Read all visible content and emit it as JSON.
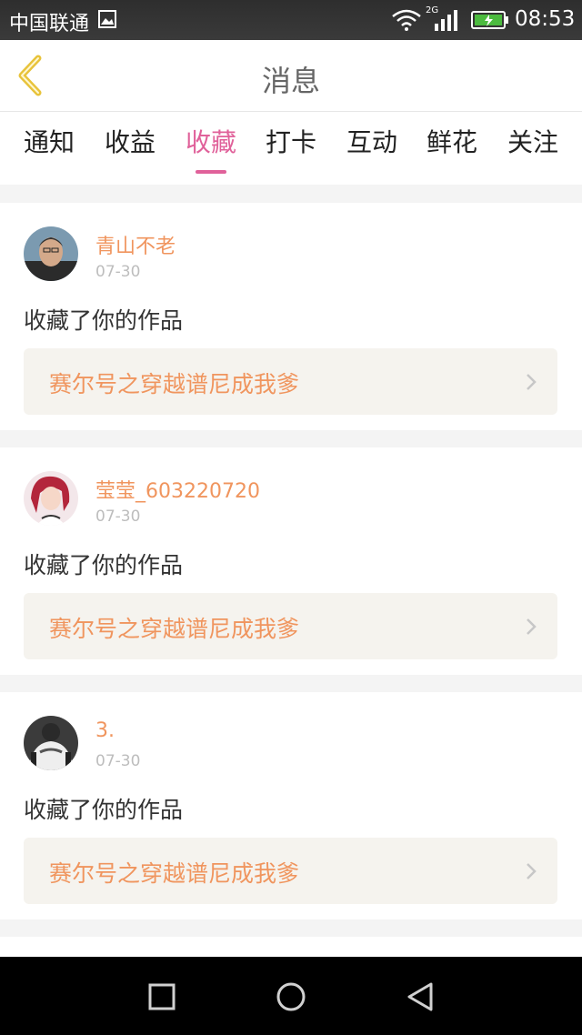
{
  "status_bar": {
    "carrier": "中国联通",
    "network": "2G",
    "time": "08:53"
  },
  "header": {
    "title": "消息"
  },
  "tabs": [
    {
      "label": "通知",
      "active": false
    },
    {
      "label": "收益",
      "active": false
    },
    {
      "label": "收藏",
      "active": true
    },
    {
      "label": "打卡",
      "active": false
    },
    {
      "label": "互动",
      "active": false
    },
    {
      "label": "鲜花",
      "active": false
    },
    {
      "label": "关注",
      "active": false
    }
  ],
  "messages": [
    {
      "username": "青山不老",
      "date": "07-30",
      "action": "收藏了你的作品",
      "work_title": "赛尔号之穿越谱尼成我爹"
    },
    {
      "username": "莹莹_603220720",
      "date": "07-30",
      "action": "收藏了你的作品",
      "work_title": "赛尔号之穿越谱尼成我爹"
    },
    {
      "username": "3.",
      "date": "07-30",
      "action": "收藏了你的作品",
      "work_title": "赛尔号之穿越谱尼成我爹"
    }
  ],
  "colors": {
    "accent_pink": "#e0619a",
    "username_orange": "#f0955e",
    "link_bg": "#f5f3ee",
    "back_arrow": "#e8c33a"
  }
}
